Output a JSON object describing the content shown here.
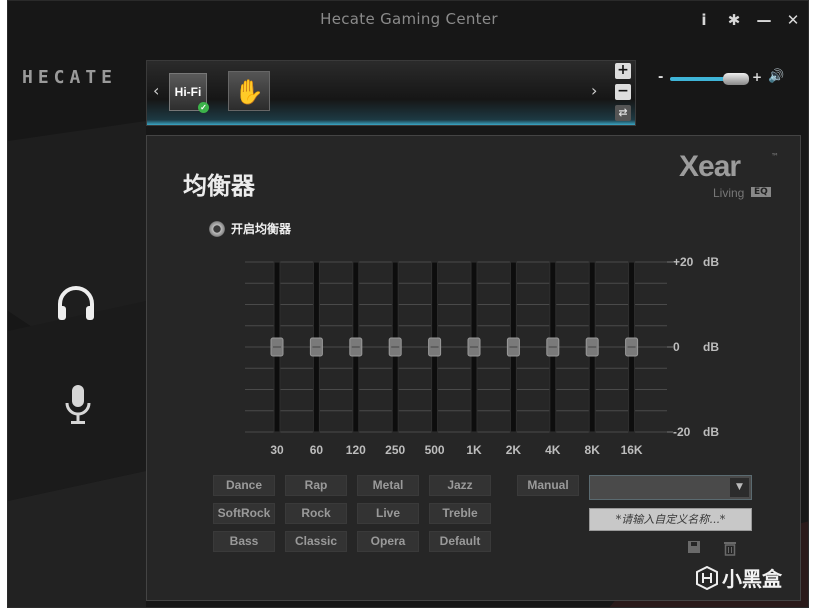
{
  "window": {
    "title": "Hecate Gaming Center"
  },
  "titlebar": {
    "info": "i",
    "settings": "✱",
    "minimize": "—",
    "close": "✕"
  },
  "brand": {
    "logo": "HECATE"
  },
  "profile_strip": {
    "prev": "‹",
    "next": "›",
    "active_profile": "Hi-Fi",
    "add": "+",
    "remove": "−",
    "swap": "⇄"
  },
  "volume": {
    "minus": "-",
    "plus": "+",
    "level": 0.85
  },
  "nav": {
    "headphones_icon": "headphones-icon",
    "mic_icon": "microphone-icon"
  },
  "eq_panel": {
    "title": "均衡器",
    "xear_brand": "Xear",
    "xear_tm": "™",
    "xear_sub": "Living",
    "xear_badge": "EQ",
    "enable_label": "开启均衡器"
  },
  "chart_data": {
    "type": "eq-sliders",
    "bands": [
      "30",
      "60",
      "120",
      "250",
      "500",
      "1K",
      "2K",
      "4K",
      "8K",
      "16K"
    ],
    "values_db": [
      0,
      0,
      0,
      0,
      0,
      0,
      0,
      0,
      0,
      0
    ],
    "ylim": [
      -20,
      20
    ],
    "ytick_labels": [
      "+20",
      "0",
      "-20"
    ],
    "yunit": "dB"
  },
  "presets": [
    [
      "Dance",
      "Rap",
      "Metal",
      "Jazz"
    ],
    [
      "SoftRock",
      "Rock",
      "Live",
      "Treble"
    ],
    [
      "Bass",
      "Classic",
      "Opera",
      "Default"
    ]
  ],
  "manual": {
    "label": "Manual"
  },
  "custom": {
    "dropdown_value": "",
    "dropdown_arrow": "▼",
    "name_placeholder": "*请输入自定义名称...*",
    "save_icon": "▪",
    "delete_icon": "🗑"
  },
  "watermark": {
    "text": "小黑盒"
  }
}
